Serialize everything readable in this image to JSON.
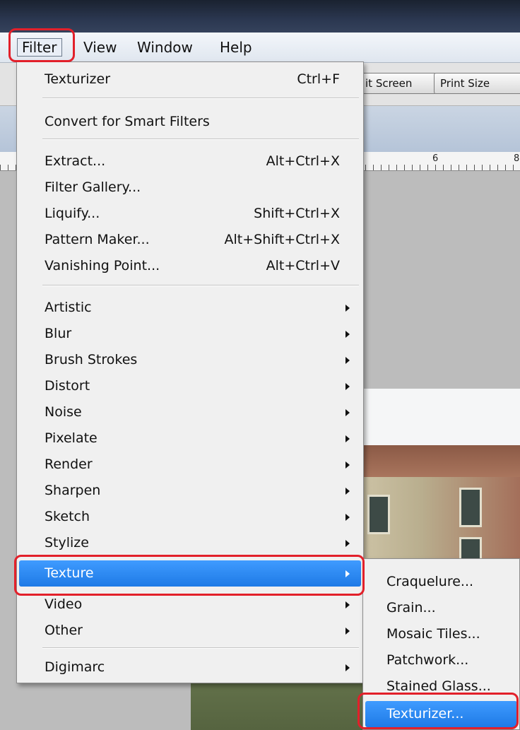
{
  "menubar": {
    "items": [
      {
        "label": "Filter"
      },
      {
        "label": "View"
      },
      {
        "label": "Window"
      },
      {
        "label": "Help"
      }
    ]
  },
  "toolbar": {
    "fit_screen": "it Screen",
    "print_size": "Print Size"
  },
  "ruler": {
    "marks": [
      "6",
      "8"
    ]
  },
  "filter_menu": {
    "items": [
      {
        "label": "Texturizer",
        "shortcut": "Ctrl+F"
      },
      {
        "label": "Convert for Smart Filters"
      },
      {
        "label": "Extract...",
        "shortcut": "Alt+Ctrl+X"
      },
      {
        "label": "Filter Gallery..."
      },
      {
        "label": "Liquify...",
        "shortcut": "Shift+Ctrl+X"
      },
      {
        "label": "Pattern Maker...",
        "shortcut": "Alt+Shift+Ctrl+X"
      },
      {
        "label": "Vanishing Point...",
        "shortcut": "Alt+Ctrl+V"
      },
      {
        "label": "Artistic"
      },
      {
        "label": "Blur"
      },
      {
        "label": "Brush Strokes"
      },
      {
        "label": "Distort"
      },
      {
        "label": "Noise"
      },
      {
        "label": "Pixelate"
      },
      {
        "label": "Render"
      },
      {
        "label": "Sharpen"
      },
      {
        "label": "Sketch"
      },
      {
        "label": "Stylize"
      },
      {
        "label": "Texture"
      },
      {
        "label": "Video"
      },
      {
        "label": "Other"
      },
      {
        "label": "Digimarc"
      }
    ]
  },
  "texture_submenu": {
    "items": [
      {
        "label": "Craquelure..."
      },
      {
        "label": "Grain..."
      },
      {
        "label": "Mosaic Tiles..."
      },
      {
        "label": "Patchwork..."
      },
      {
        "label": "Stained Glass..."
      },
      {
        "label": "Texturizer..."
      }
    ]
  },
  "colors": {
    "highlight": "#e2202a",
    "selection": "#1e7ae6"
  }
}
